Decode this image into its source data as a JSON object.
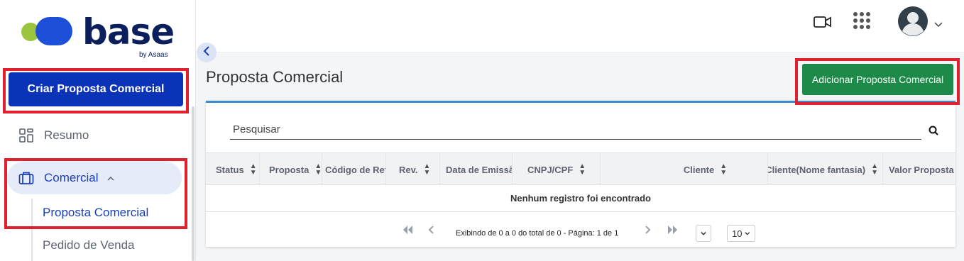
{
  "brand": {
    "name": "base",
    "sub": "by Asaas"
  },
  "sidebar": {
    "create_button": "Criar Proposta Comercial",
    "items": [
      {
        "label": "Resumo",
        "icon": "dashboard-icon"
      },
      {
        "label": "Comercial",
        "icon": "briefcase-icon"
      }
    ],
    "subitems": [
      {
        "label": "Proposta Comercial",
        "active": true
      },
      {
        "label": "Pedido de Venda",
        "active": false
      }
    ]
  },
  "topbar": {
    "icons": [
      "video-icon",
      "apps-grid-icon",
      "user-avatar-icon",
      "chevron-down-icon"
    ]
  },
  "main": {
    "title": "Proposta Comercial",
    "add_button": "Adicionar Proposta Comercial",
    "search_placeholder": "Pesquisar",
    "columns": [
      "Status",
      "Proposta",
      "Código de Refe",
      "Rev.",
      "Data de Emissão",
      "CNPJ/CPF",
      "Cliente",
      "Cliente(Nome fantasia)",
      "Valor Proposta"
    ],
    "empty_message": "Nenhum registro foi encontrado",
    "pagination": {
      "info": "Exibindo de 0 a 0 do total de 0 - Página: 1 de 1",
      "page_select": "",
      "per_page": "10"
    }
  },
  "colors": {
    "primary_blue": "#0b33b8",
    "add_green": "#1e8a49",
    "highlight_red": "#e0202c",
    "card_accent": "#3a8ed0"
  }
}
